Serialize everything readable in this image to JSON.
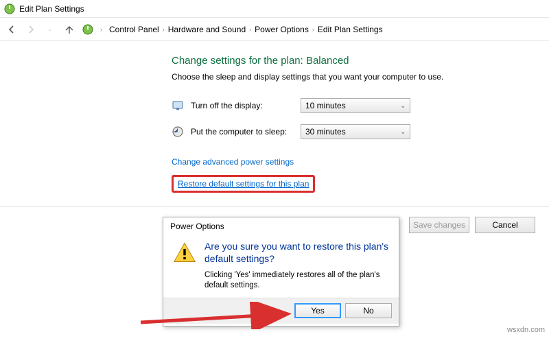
{
  "window": {
    "title": "Edit Plan Settings"
  },
  "breadcrumbs": {
    "b0": "Control Panel",
    "b1": "Hardware and Sound",
    "b2": "Power Options",
    "b3": "Edit Plan Settings"
  },
  "main": {
    "heading": "Change settings for the plan: Balanced",
    "description": "Choose the sleep and display settings that you want your computer to use.",
    "row1_label": "Turn off the display:",
    "row1_value": "10 minutes",
    "row2_label": "Put the computer to sleep:",
    "row2_value": "30 minutes",
    "link_adv": "Change advanced power settings",
    "link_restore": "Restore default settings for this plan"
  },
  "footer": {
    "save": "Save changes",
    "cancel": "Cancel"
  },
  "dialog": {
    "title": "Power Options",
    "heading": "Are you sure you want to restore this plan's default settings?",
    "message": "Clicking 'Yes' immediately restores all of the plan's default settings.",
    "yes": "Yes",
    "no": "No"
  },
  "watermark": "wsxdn.com"
}
